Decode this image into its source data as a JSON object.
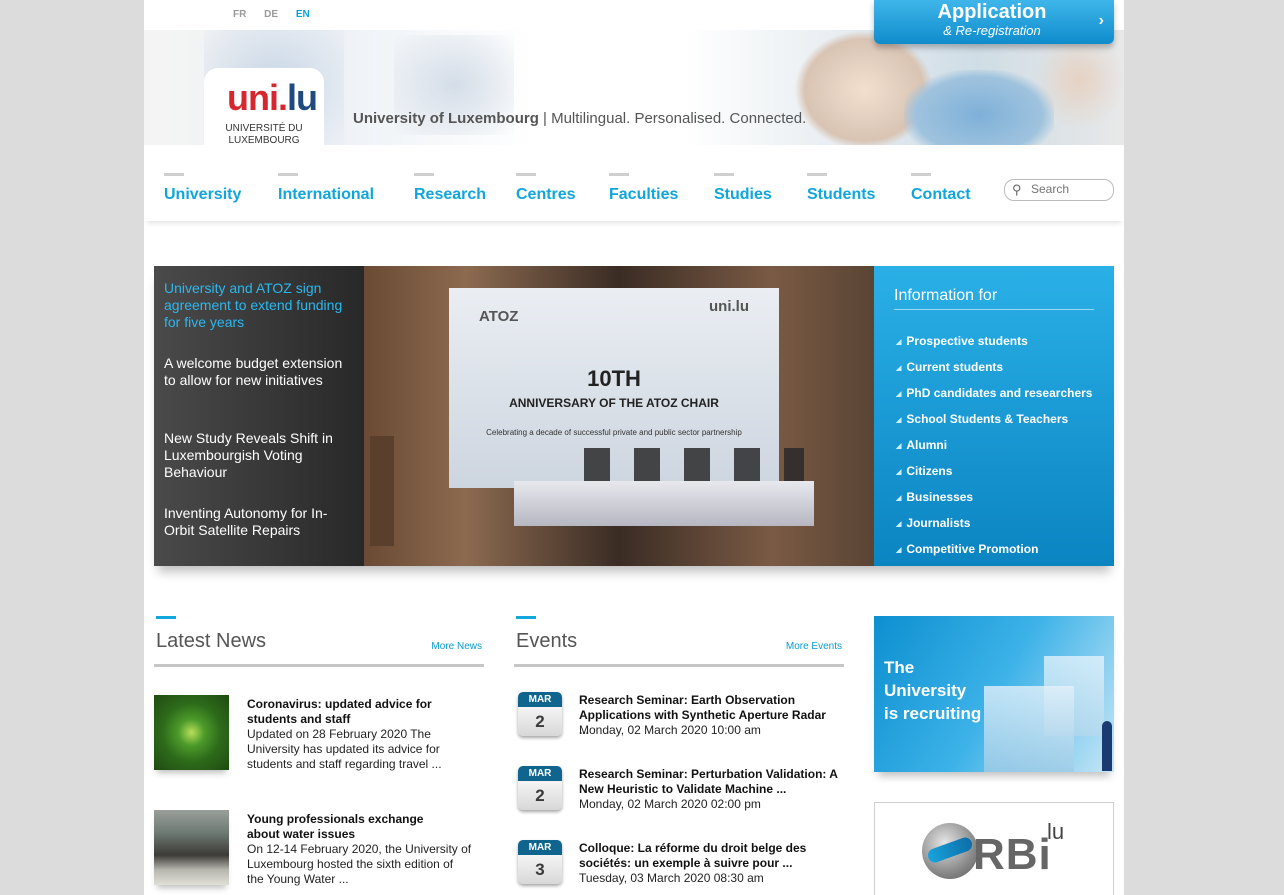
{
  "languages": [
    {
      "label": "FR",
      "active": false
    },
    {
      "label": "DE",
      "active": false
    },
    {
      "label": "EN",
      "active": true
    }
  ],
  "application_button": {
    "title": "Application",
    "subtitle": "& Re-registration"
  },
  "logo": {
    "mark_main": "uni.",
    "mark_accent": "lu",
    "line1": "UNIVERSITÉ DU",
    "line2": "LUXEMBOURG"
  },
  "tagline": {
    "bold": "University of Luxembourg",
    "rest": " | Multilingual. Personalised. Connected."
  },
  "nav": [
    "University",
    "International",
    "Research",
    "Centres",
    "Faculties",
    "Studies",
    "Students",
    "Contact"
  ],
  "search": {
    "placeholder": "Search"
  },
  "feature": {
    "stories": [
      "University and ATOZ sign agreement to extend funding for five years",
      "A welcome budget extension to allow for new initiatives",
      "New Study Reveals Shift in Luxembourgish Voting Behaviour",
      "Inventing Autonomy for In-Orbit Satellite Repairs"
    ],
    "photo": {
      "left_logo": "ATOZ",
      "right_logo": "uni.lu",
      "number": "10TH",
      "headline": "ANNIVERSARY OF THE ATOZ CHAIR",
      "subline": "Celebrating a decade of successful private and public sector partnership"
    }
  },
  "info_for": {
    "title": "Information for",
    "items": [
      "Prospective students",
      "Current students",
      "PhD candidates and researchers",
      "School Students & Teachers",
      "Alumni",
      "Citizens",
      "Businesses",
      "Journalists",
      "Competitive Promotion"
    ]
  },
  "latest_news": {
    "title": "Latest News",
    "more": "More News",
    "items": [
      {
        "headline": "Coronavirus: updated advice for students and staff",
        "summary": "Updated on 28 February 2020 The University has updated its advice for students and staff regarding travel ..."
      },
      {
        "headline": "Young professionals exchange about water issues",
        "summary": "On 12-14 February 2020, the University of Luxembourg hosted the sixth edition of the Young Water ..."
      }
    ]
  },
  "events": {
    "title": "Events",
    "more": "More Events",
    "items": [
      {
        "month": "MAR",
        "day": "2",
        "title": "Research Seminar: Earth Observation Applications with Synthetic Aperture Radar ...",
        "datetime": "Monday, 02 March 2020 10:00 am"
      },
      {
        "month": "MAR",
        "day": "2",
        "title": "Research Seminar: Perturbation Validation: A New Heuristic to Validate Machine ...",
        "datetime": "Monday, 02 March 2020 02:00 pm"
      },
      {
        "month": "MAR",
        "day": "3",
        "title": "Colloque: La réforme du droit belge des sociétés: un exemple à suivre pour ...",
        "datetime": "Tuesday, 03 March 2020 08:30 am"
      }
    ]
  },
  "recruiting": {
    "line1": "The",
    "line2": "University",
    "line3": "is recruiting"
  },
  "orbi": {
    "word": "RBi",
    "suffix": "lu"
  },
  "colors": {
    "accent": "#10a6dc",
    "brand_red": "#d8262f",
    "brand_blue": "#1f4a80",
    "calendar": "#10658f"
  }
}
